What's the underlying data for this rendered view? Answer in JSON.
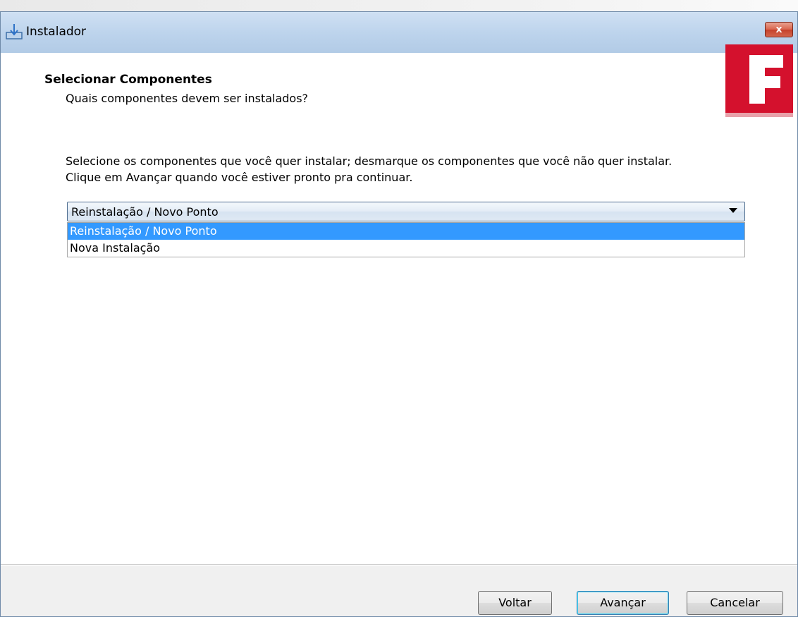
{
  "window": {
    "title": "Instalador",
    "close_label": "x"
  },
  "page": {
    "heading": "Selecionar Componentes",
    "subheading": "Quais componentes devem ser instalados?",
    "instructions_line1": "Selecione os componentes que você quer instalar; desmarque os componentes que você não quer instalar.",
    "instructions_line2": "Clique em Avançar quando você estiver pronto pra continuar.",
    "logo_letter": "F",
    "logo_color": "#d4112d"
  },
  "combo": {
    "selected_value": "Reinstalação / Novo Ponto",
    "options": [
      "Reinstalação / Novo Ponto",
      "Nova Instalação"
    ]
  },
  "footer": {
    "back_label": "Voltar",
    "next_label": "Avançar",
    "cancel_label": "Cancelar"
  }
}
